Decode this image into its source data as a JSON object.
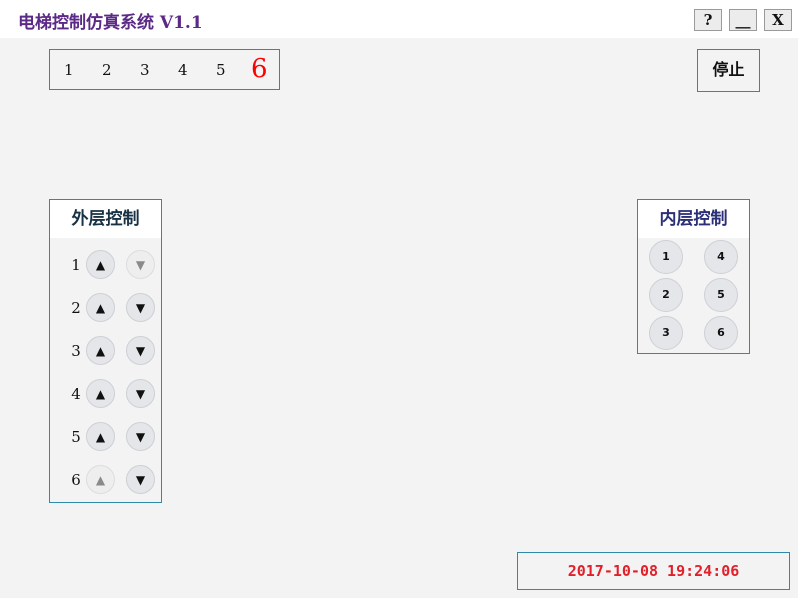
{
  "window": {
    "title": "电梯控制仿真系统 V1.1",
    "help_label": "?",
    "minimize_label": "__",
    "close_label": "X"
  },
  "floor_indicator": {
    "floors": [
      "1",
      "2",
      "3",
      "4",
      "5",
      "6"
    ],
    "current_floor": "6",
    "current_color": "#ff0000"
  },
  "stop_button": {
    "label": "停止"
  },
  "outer_control": {
    "title": "外层控制",
    "rows": [
      {
        "floor": "1",
        "up": "▲",
        "down": "▼",
        "up_enabled": true,
        "down_enabled": false
      },
      {
        "floor": "2",
        "up": "▲",
        "down": "▼",
        "up_enabled": true,
        "down_enabled": true
      },
      {
        "floor": "3",
        "up": "▲",
        "down": "▼",
        "up_enabled": true,
        "down_enabled": true
      },
      {
        "floor": "4",
        "up": "▲",
        "down": "▼",
        "up_enabled": true,
        "down_enabled": true
      },
      {
        "floor": "5",
        "up": "▲",
        "down": "▼",
        "up_enabled": true,
        "down_enabled": true
      },
      {
        "floor": "6",
        "up": "▲",
        "down": "▼",
        "up_enabled": false,
        "down_enabled": true
      }
    ]
  },
  "inner_control": {
    "title": "内层控制",
    "buttons": [
      "1",
      "2",
      "3",
      "4",
      "5",
      "6"
    ]
  },
  "clock": {
    "datetime": "2017-10-08 19:24:06",
    "color": "#e0202a"
  },
  "colors": {
    "accent_border": "#2e8aa6",
    "title": "#5b2a86",
    "background": "#f3f3f3"
  }
}
